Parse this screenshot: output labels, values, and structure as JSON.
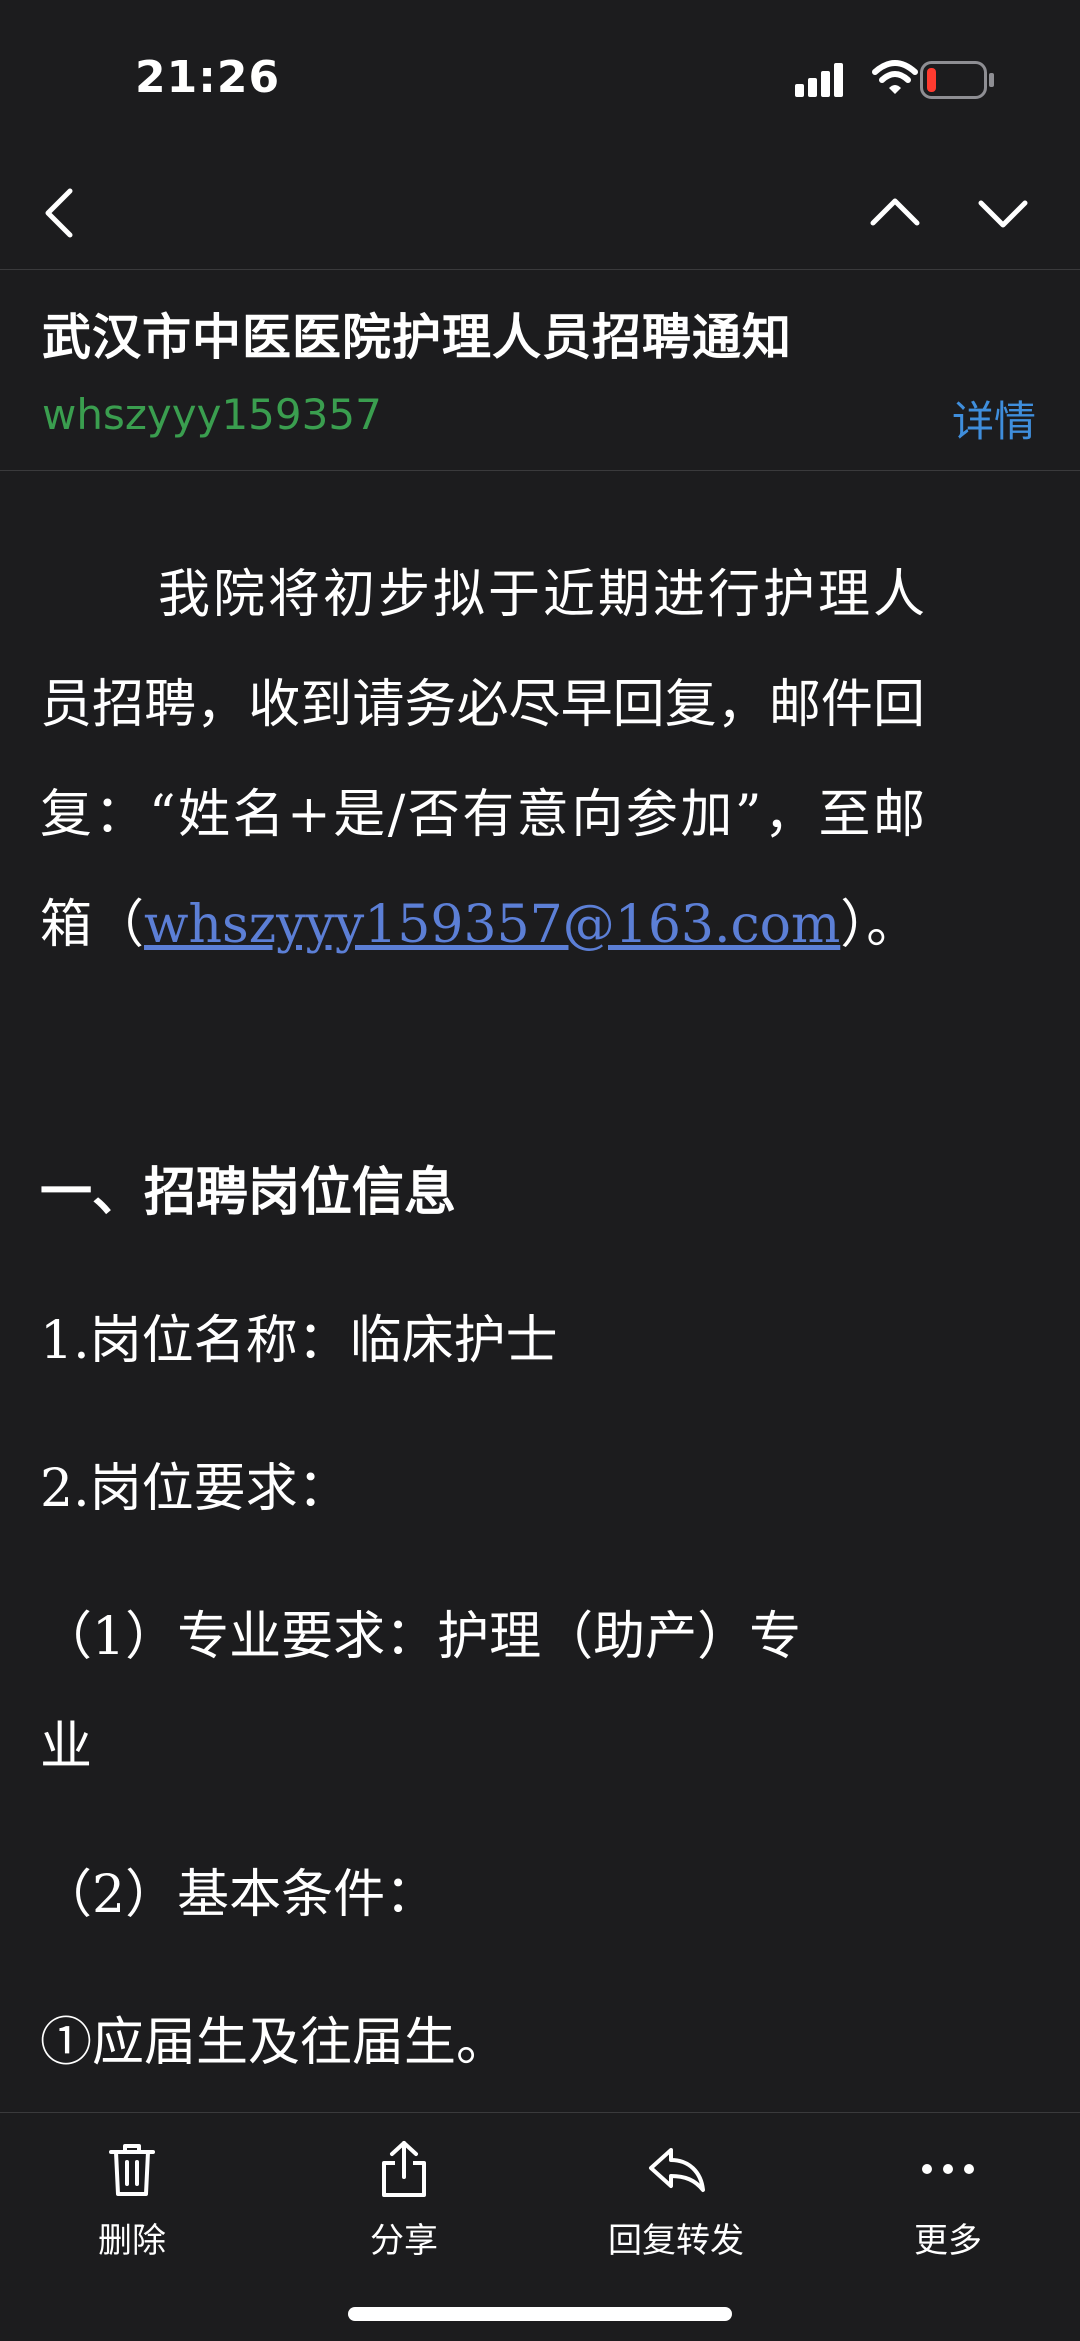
{
  "status_bar": {
    "time": "21:26",
    "signal_icon": "cellular-signal-icon",
    "wifi_icon": "wifi-icon",
    "battery_icon": "battery-low-icon",
    "battery_color": "#ff3b30"
  },
  "nav": {
    "back_icon": "chevron-left-icon",
    "prev_icon": "chevron-up-icon",
    "next_icon": "chevron-down-icon"
  },
  "header": {
    "subject": "武汉市中医医院护理人员招聘通知",
    "sender": "whszyyy159357",
    "details_label": "详情"
  },
  "body": {
    "intro_before": "我院将初步拟于近期进行护理人员招聘，收到请务必尽早回复，邮件回复：“姓名+是/否有意向参加”，至邮箱（",
    "email": "whszyyy159357@163.com",
    "intro_after": "）。",
    "section_title": "一、招聘岗位信息",
    "lines": [
      "1.岗位名称：临床护士",
      "2.岗位要求：",
      "（1）专业要求：护理（助产）专",
      "业",
      "（2）基本条件：",
      "①应届生及往届生。"
    ]
  },
  "toolbar": {
    "items": [
      {
        "label": "删除",
        "icon": "trash-icon"
      },
      {
        "label": "分享",
        "icon": "share-icon"
      },
      {
        "label": "回复转发",
        "icon": "reply-icon"
      },
      {
        "label": "更多",
        "icon": "more-icon"
      }
    ]
  },
  "colors": {
    "background": "#1c1c1e",
    "sender_green": "#3a9e4f",
    "link_blue": "#3f8edc",
    "email_link": "#5c7fd6"
  }
}
